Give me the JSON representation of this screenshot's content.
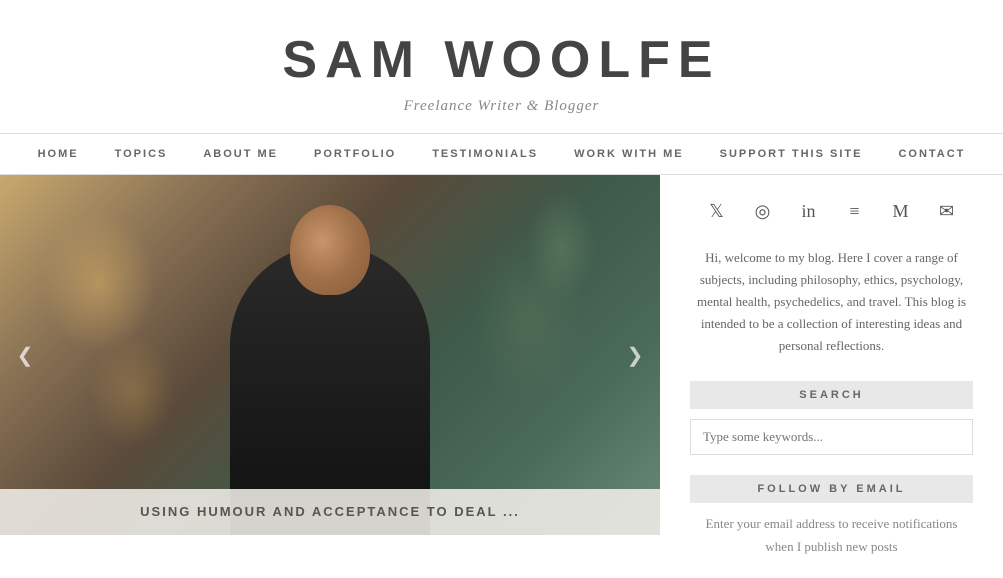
{
  "header": {
    "title": "SAM WOOLFE",
    "tagline": "Freelance Writer & Blogger"
  },
  "nav": {
    "items": [
      {
        "label": "HOME",
        "id": "home"
      },
      {
        "label": "TOPICS",
        "id": "topics"
      },
      {
        "label": "ABOUT ME",
        "id": "about-me"
      },
      {
        "label": "PORTFOLIO",
        "id": "portfolio"
      },
      {
        "label": "TESTIMONIALS",
        "id": "testimonials"
      },
      {
        "label": "WORK WITH ME",
        "id": "work-with-me"
      },
      {
        "label": "SUPPORT THIS SITE",
        "id": "support"
      },
      {
        "label": "CONTACT",
        "id": "contact"
      }
    ]
  },
  "hero": {
    "post_title": "USING HUMOUR AND ACCEPTANCE TO DEAL ...",
    "prev_arrow": "❮",
    "next_arrow": "❯"
  },
  "sidebar": {
    "social_icons": [
      {
        "id": "twitter",
        "symbol": "𝕏",
        "name": "twitter-icon"
      },
      {
        "id": "instagram",
        "symbol": "◎",
        "name": "instagram-icon"
      },
      {
        "id": "linkedin",
        "symbol": "in",
        "name": "linkedin-icon"
      },
      {
        "id": "rss",
        "symbol": "≡",
        "name": "rss-icon"
      },
      {
        "id": "medium",
        "symbol": "M",
        "name": "medium-icon"
      },
      {
        "id": "email",
        "symbol": "✉",
        "name": "email-icon"
      }
    ],
    "bio_text": "Hi, welcome to my blog. Here I cover a range of subjects, including philosophy, ethics, psychology, mental health, psychedelics, and travel. This blog is intended to be a collection of interesting ideas and personal reflections.",
    "search": {
      "widget_title": "SEARCH",
      "placeholder": "Type some keywords..."
    },
    "follow": {
      "widget_title": "FOLLOW BY EMAIL",
      "text": "Enter your email address to receive notifications when I publish new posts"
    }
  }
}
